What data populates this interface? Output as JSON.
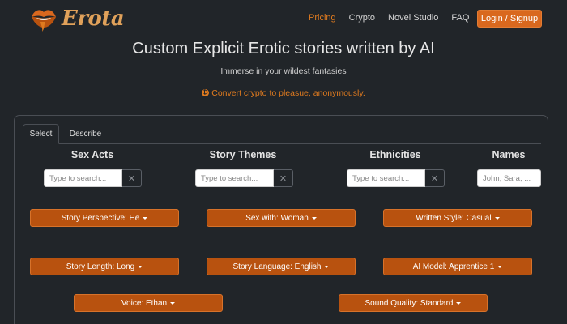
{
  "brand": {
    "name": "Erota"
  },
  "nav": {
    "links": [
      "Pricing",
      "Crypto",
      "Novel Studio",
      "FAQ"
    ],
    "active": "Pricing",
    "login_label": "Login / Signup"
  },
  "hero": {
    "title": "Custom Explicit Erotic stories written by AI",
    "subtitle": "Immerse in your wildest fantasies",
    "crypto_text": "Convert crypto to pleasue, anonymously."
  },
  "tabs": [
    "Select",
    "Describe"
  ],
  "filters": {
    "headers": [
      "Sex Acts",
      "Story Themes",
      "Ethnicities",
      "Names"
    ],
    "placeholders": [
      "Type to search...",
      "Type to search...",
      "Type to search...",
      "John, Sara, ..."
    ]
  },
  "dropdowns": [
    "Story Perspective: He",
    "Sex with: Woman",
    "Written Style: Casual",
    "Story Length: Long",
    "Story Language: English",
    "AI Model: Apprentice 1",
    "Voice: Ethan",
    "Sound Quality: Standard"
  ],
  "colors": {
    "accent": "#e07b1f",
    "button": "#b8520f",
    "background": "#212529"
  }
}
